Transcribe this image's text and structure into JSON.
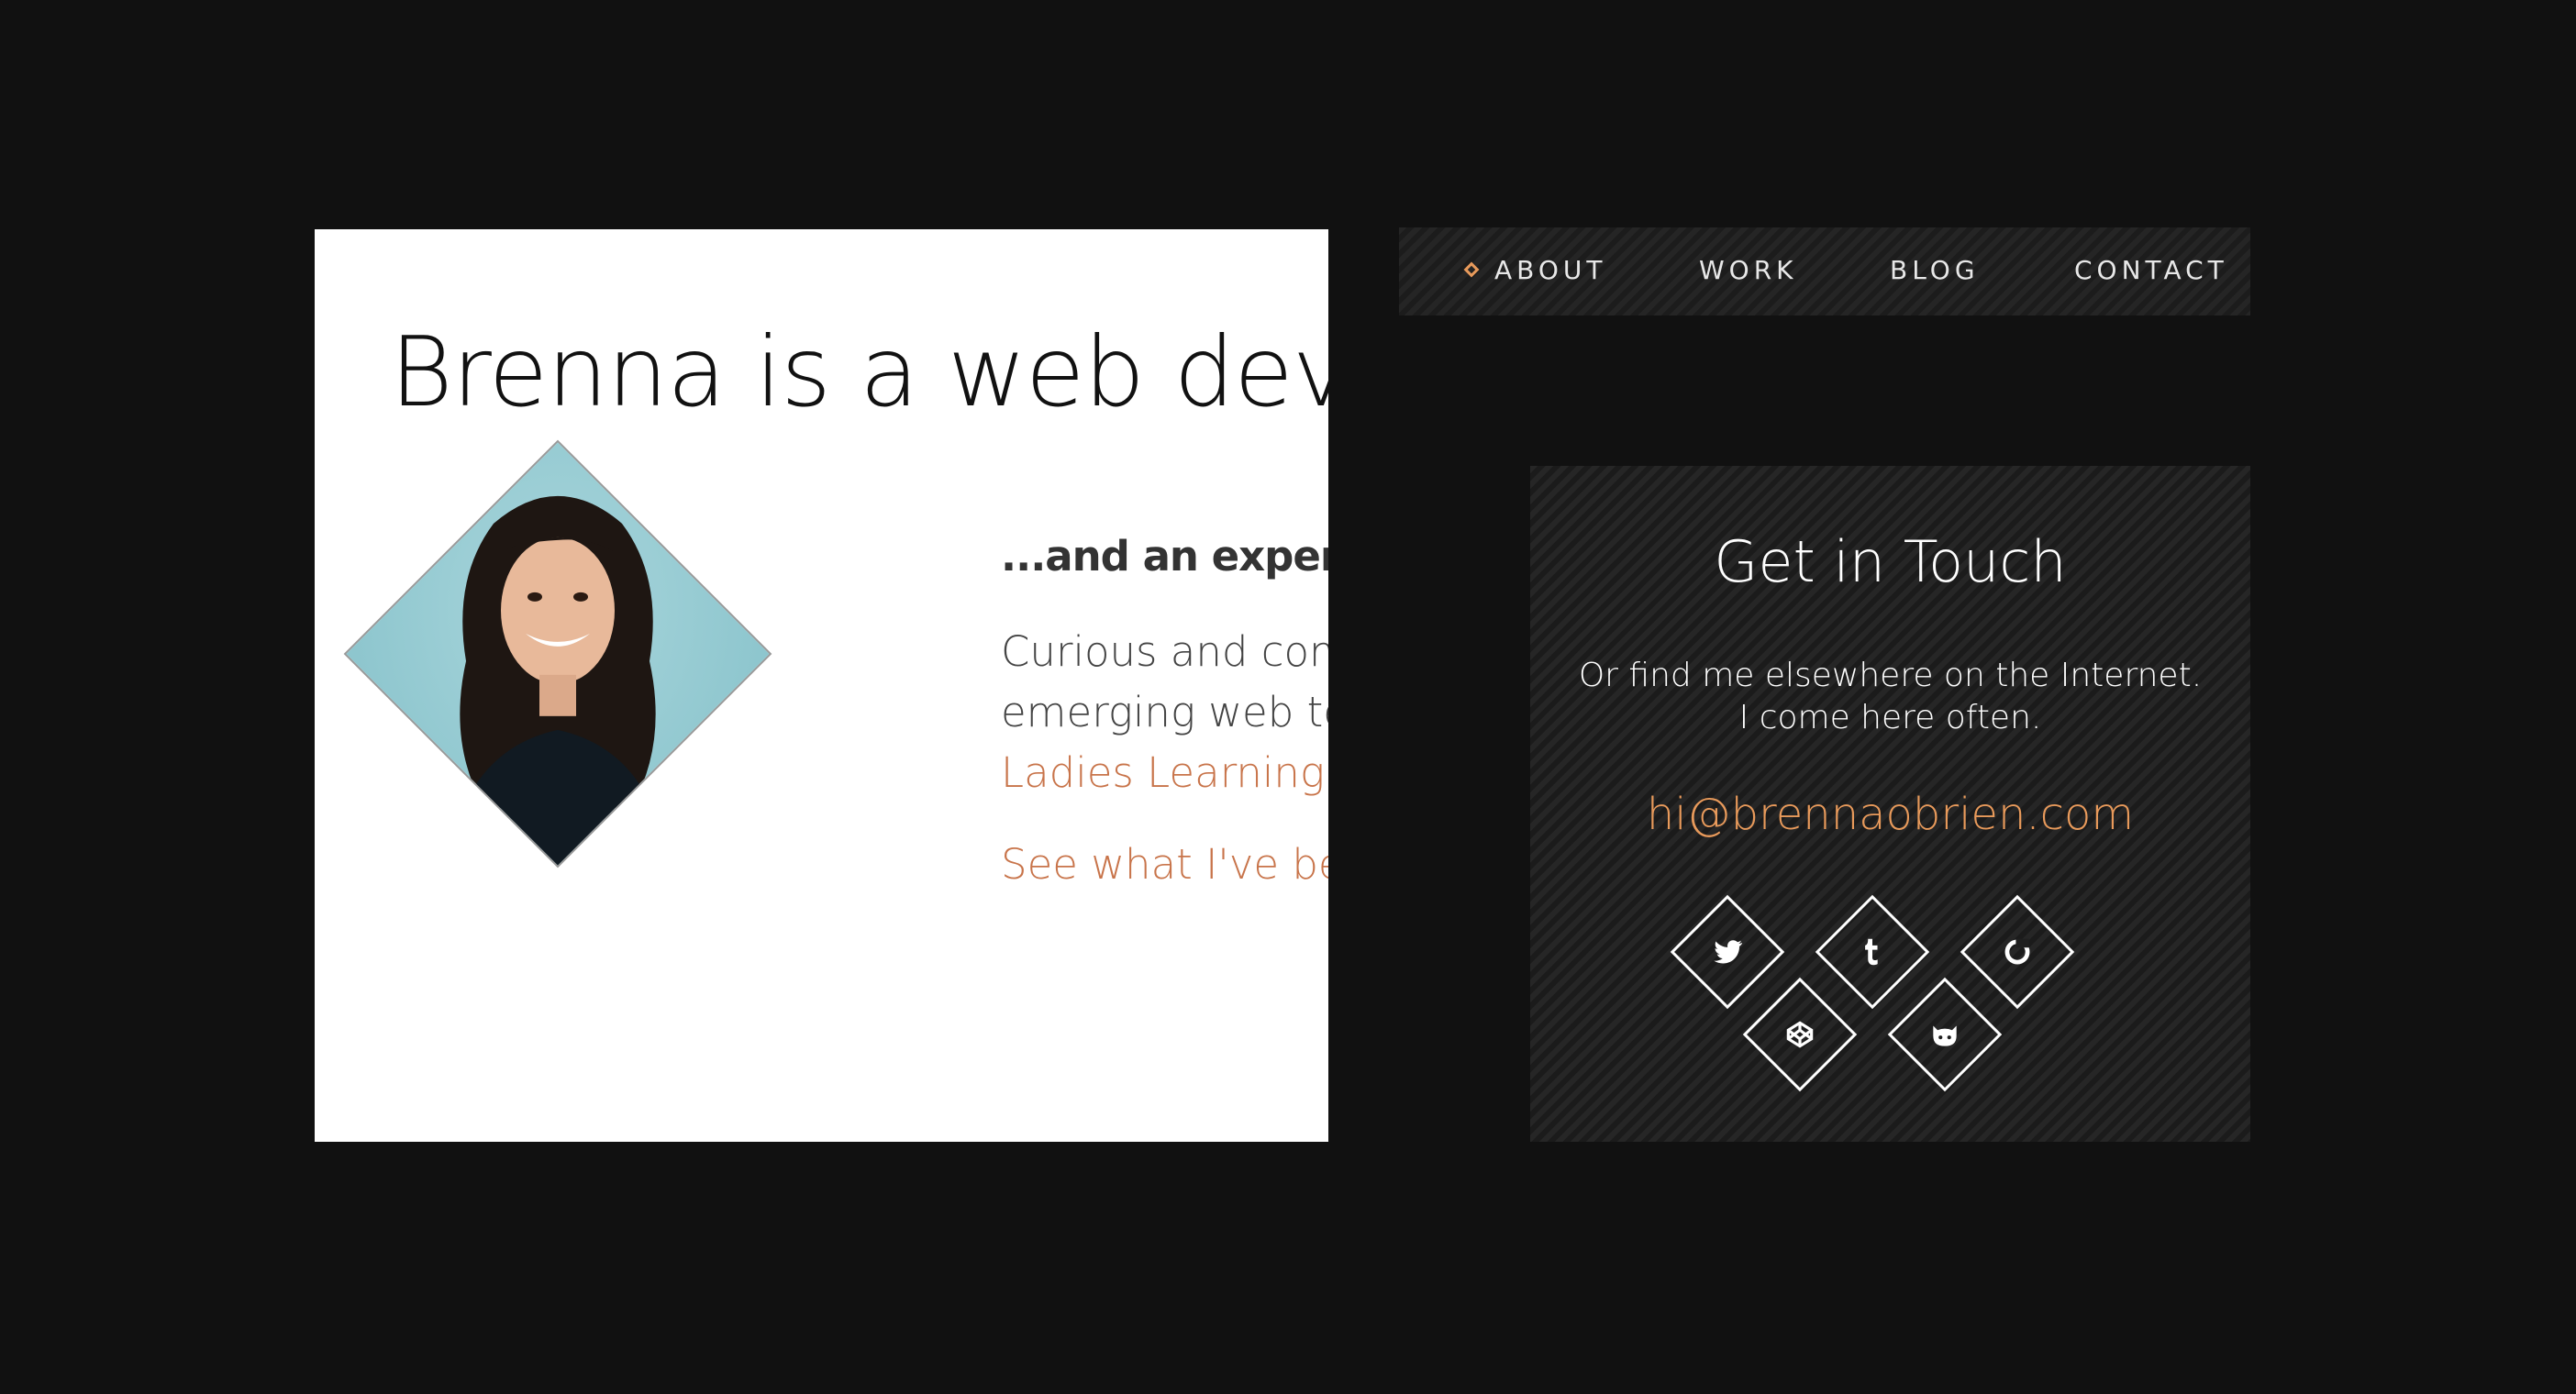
{
  "about": {
    "headline": "Brenna is a web develop",
    "subhead": "...and an expert in",
    "lines": [
      "Curious and comm",
      "emerging web tec"
    ],
    "accent_line": "Ladies Learning C",
    "see_link": "See what I've been"
  },
  "nav": {
    "items": [
      "ABOUT",
      "WORK",
      "BLOG",
      "CONTACT"
    ],
    "active": "ABOUT"
  },
  "contact": {
    "title": "Get in Touch",
    "subtitle_line1": "Or find me elsewhere on the Internet.",
    "subtitle_line2": "I come here often.",
    "email": "hi@brennaobrien.com",
    "social_icons": [
      "twitter-icon",
      "tumblr-icon",
      "dribbble-icon",
      "codepen-icon",
      "github-icon"
    ]
  },
  "colors": {
    "background": "#111111",
    "accent": "#e89a5b",
    "link": "#c8744a",
    "text_dark": "#111111"
  }
}
